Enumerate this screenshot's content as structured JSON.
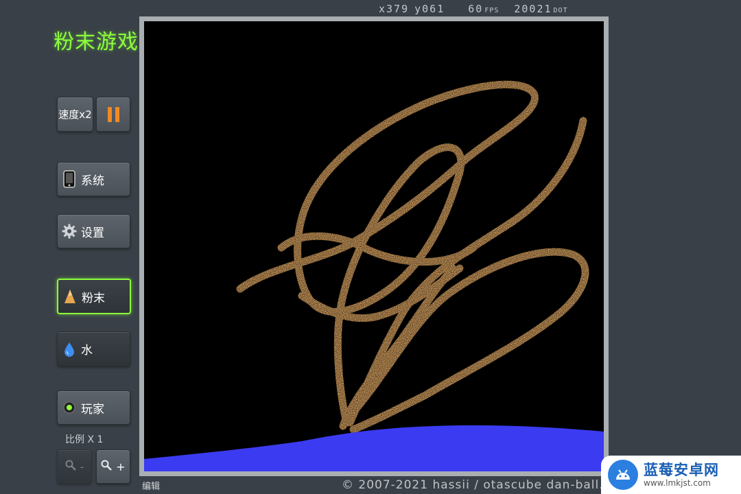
{
  "app": {
    "title": "粉末游戏"
  },
  "stats": {
    "x": "x379",
    "y": "y061",
    "fps_value": "60",
    "fps_unit": "FPS",
    "dot_value": "20021",
    "dot_unit": "DOT"
  },
  "controls": {
    "speed_label": "速度x2",
    "system_label": "系统",
    "settings_label": "设置",
    "powder_label": "粉末",
    "water_label": "水",
    "player_label": "玩家",
    "scale_label": "比例 X 1",
    "zoom_out_label": "-",
    "zoom_in_label": "+"
  },
  "footer": {
    "edit_label": "编辑",
    "copyright": "© 2007-2021 hassii / otascube dan-ball.jp"
  },
  "watermark": {
    "name": "蓝莓安卓网",
    "url": "www.lmkjst.com"
  },
  "colors": {
    "accent": "#8dff3a",
    "sand": "#f2b56b",
    "water": "#3b3bf2",
    "pause": "#f08a24"
  }
}
